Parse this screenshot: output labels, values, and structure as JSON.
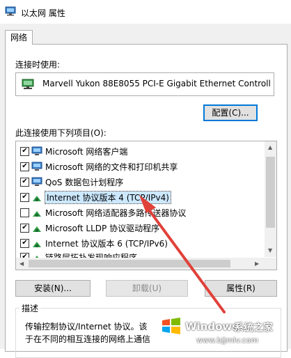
{
  "window": {
    "title": "以太网 属性"
  },
  "tabs": [
    {
      "label": "网络"
    }
  ],
  "connect_using": {
    "label": "连接时使用:",
    "adapter_name": "Marvell Yukon 88E8055 PCI-E Gigabit Ethernet Controll",
    "icon": "network-adapter-icon"
  },
  "buttons": {
    "configure": "配置(C)...",
    "install": "安装(N)...",
    "uninstall": "卸载(U)",
    "properties": "属性(R)"
  },
  "items_label": "此连接使用下列项目(O):",
  "items": [
    {
      "label": "Microsoft 网络客户端",
      "checked": true,
      "icon": "network-client-icon"
    },
    {
      "label": "Microsoft 网络的文件和打印机共享",
      "checked": true,
      "icon": "network-client-icon"
    },
    {
      "label": "QoS 数据包计划程序",
      "checked": true,
      "icon": "network-client-icon"
    },
    {
      "label": "Internet 协议版本 4 (TCP/IPv4)",
      "checked": true,
      "icon": "protocol-icon",
      "selected": true
    },
    {
      "label": "Microsoft 网络适配器多路传送器协议",
      "checked": false,
      "icon": "protocol-icon"
    },
    {
      "label": "Microsoft LLDP 协议驱动程序",
      "checked": true,
      "icon": "protocol-icon"
    },
    {
      "label": "Internet 协议版本 6 (TCP/IPv6)",
      "checked": true,
      "icon": "protocol-icon"
    },
    {
      "label": "链路层拓扑发现响应程序",
      "checked": true,
      "icon": "protocol-icon"
    }
  ],
  "description": {
    "legend": "描述",
    "lines": [
      "传输控制协议/Internet 协议。该",
      "于在不同的相互连接的网络上通信"
    ]
  },
  "watermark": {
    "brand": "Windows",
    "site": "系统之家",
    "url": "www.bjjmlv.com"
  },
  "colors": {
    "selection": "#cce8ff",
    "annotation_arrow": "#e0413a",
    "accent": "#0078d7"
  }
}
